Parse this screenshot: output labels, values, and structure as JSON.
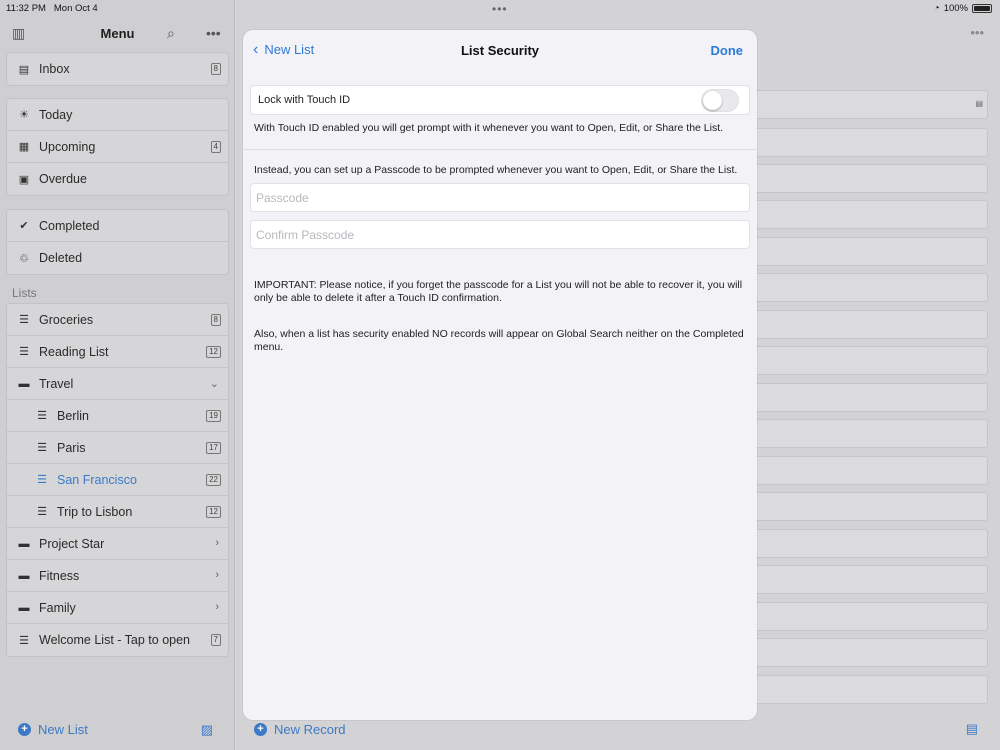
{
  "status": {
    "time": "11:32 PM",
    "date": "Mon Oct 4",
    "battery": "100%",
    "wifi_icon": "wifi-icon"
  },
  "sidebar": {
    "title": "Menu",
    "group1": [
      {
        "label": "Inbox",
        "badge": "8",
        "icon": "tray-icon"
      }
    ],
    "group2": [
      {
        "label": "Today",
        "icon": "sun-icon"
      },
      {
        "label": "Upcoming",
        "badge": "4",
        "icon": "calendar-icon"
      },
      {
        "label": "Overdue",
        "icon": "tray-full-icon"
      }
    ],
    "group3": [
      {
        "label": "Completed",
        "icon": "checkmark-circle-icon"
      },
      {
        "label": "Deleted",
        "icon": "trash-icon"
      }
    ],
    "lists_label": "Lists",
    "lists": [
      {
        "label": "Groceries",
        "badge": "8"
      },
      {
        "label": "Reading List",
        "badge": "12"
      },
      {
        "label": "Travel"
      },
      {
        "label": "Berlin",
        "badge": "19"
      },
      {
        "label": "Paris",
        "badge": "17"
      },
      {
        "label": "San Francisco",
        "badge": "22"
      },
      {
        "label": "Trip to Lisbon",
        "badge": "12"
      },
      {
        "label": "Project Star"
      },
      {
        "label": "Fitness"
      },
      {
        "label": "Family"
      },
      {
        "label": "Welcome List - Tap to open",
        "badge": "7"
      }
    ],
    "new_list": "New List"
  },
  "main": {
    "new_record": "New Record"
  },
  "modal": {
    "back_label": "New List",
    "title": "List Security",
    "done_label": "Done",
    "touch_id_label": "Lock with Touch ID",
    "touch_id_enabled": false,
    "touch_id_note": "With Touch ID enabled you will get prompt with it whenever you want to Open, Edit, or Share the List.",
    "passcode_note": "Instead, you can set up a Passcode to be prompted whenever you want to Open, Edit, or Share the List.",
    "passcode_placeholder": "Passcode",
    "confirm_placeholder": "Confirm Passcode",
    "important_note": "IMPORTANT: Please notice, if you forget the passcode for a List you will not be able to recover it, you will only be able to delete it after a Touch ID confirmation.",
    "search_note": "Also, when a list has security enabled NO records will appear on Global Search neither on the Completed menu."
  }
}
